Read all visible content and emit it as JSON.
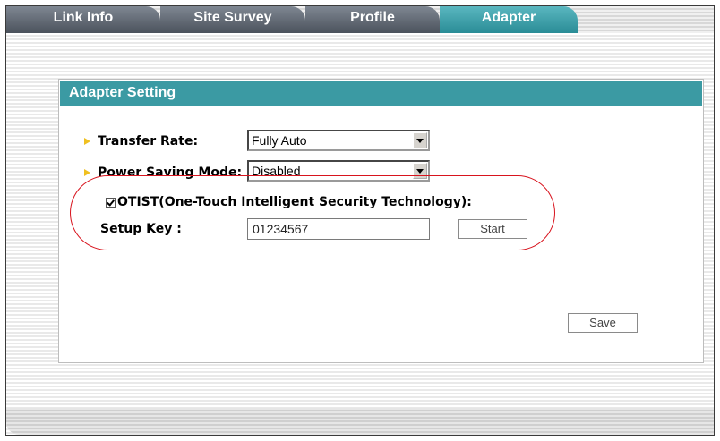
{
  "tabs": [
    {
      "label": "Link Info",
      "active": false
    },
    {
      "label": "Site Survey",
      "active": false
    },
    {
      "label": "Profile",
      "active": false
    },
    {
      "label": "Adapter",
      "active": true
    }
  ],
  "panel": {
    "title": "Adapter Setting",
    "transfer_rate": {
      "label": "Transfer Rate:",
      "value": "Fully Auto"
    },
    "power_saving": {
      "label": "Power Saving Mode:",
      "value": "Disabled"
    },
    "otist": {
      "label": "OTIST(One-Touch Intelligent Security Technology):",
      "checked": true
    },
    "setup_key": {
      "label": "Setup Key :",
      "value": "01234567"
    },
    "start_label": "Start",
    "save_label": "Save"
  },
  "colors": {
    "accent": "#3b9aa3",
    "tab_inactive": "#5e6670",
    "highlight": "#d8141e",
    "bullet": "#f0c020"
  }
}
